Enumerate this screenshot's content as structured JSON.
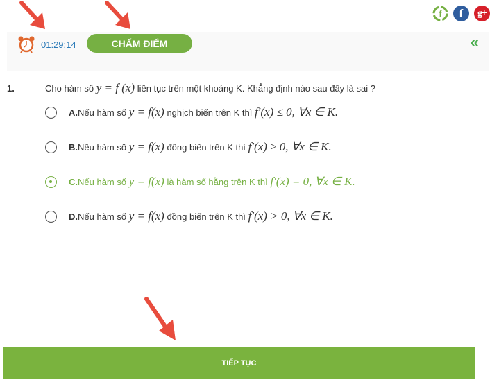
{
  "social": [
    {
      "name": "fanpage",
      "glyph": "f"
    },
    {
      "name": "facebook",
      "glyph": "f"
    },
    {
      "name": "google-plus",
      "glyph": "g+"
    }
  ],
  "header": {
    "timer": "01:29:14",
    "grade_button": "CHẤM ĐIỂM",
    "collapse_glyph": "«"
  },
  "question": {
    "number": "1.",
    "prefix": "Cho hàm số",
    "math": "y = f (x)",
    "suffix": "liên tục trên một khoảng K. Khẳng định nào sau đây là sai ?",
    "selected": "C",
    "options": [
      {
        "label": "A.",
        "pre": "Nếu hàm số",
        "m1": "y = f(x)",
        "mid": "nghịch biến trên K thì",
        "m2": "f′(x) ≤ 0, ∀x ∈ K."
      },
      {
        "label": "B.",
        "pre": "Nếu hàm số",
        "m1": "y = f(x)",
        "mid": "đồng biến trên K thì",
        "m2": "f′(x) ≥ 0, ∀x ∈ K."
      },
      {
        "label": "C.",
        "pre": "Nếu hàm số",
        "m1": "y = f(x)",
        "mid": "là hàm số hằng trên K thì",
        "m2": "f′(x) = 0, ∀x ∈ K."
      },
      {
        "label": "D.",
        "pre": "Nếu hàm số",
        "m1": "y = f(x)",
        "mid": "đồng biến trên K thì",
        "m2": "f′(x) > 0, ∀x ∈ K."
      }
    ]
  },
  "footer": {
    "continue_button": "TIẾP TỤC"
  },
  "colors": {
    "accent_green": "#76b043",
    "timer_blue": "#2b7ab8",
    "annotation_red": "#e84c3d"
  }
}
